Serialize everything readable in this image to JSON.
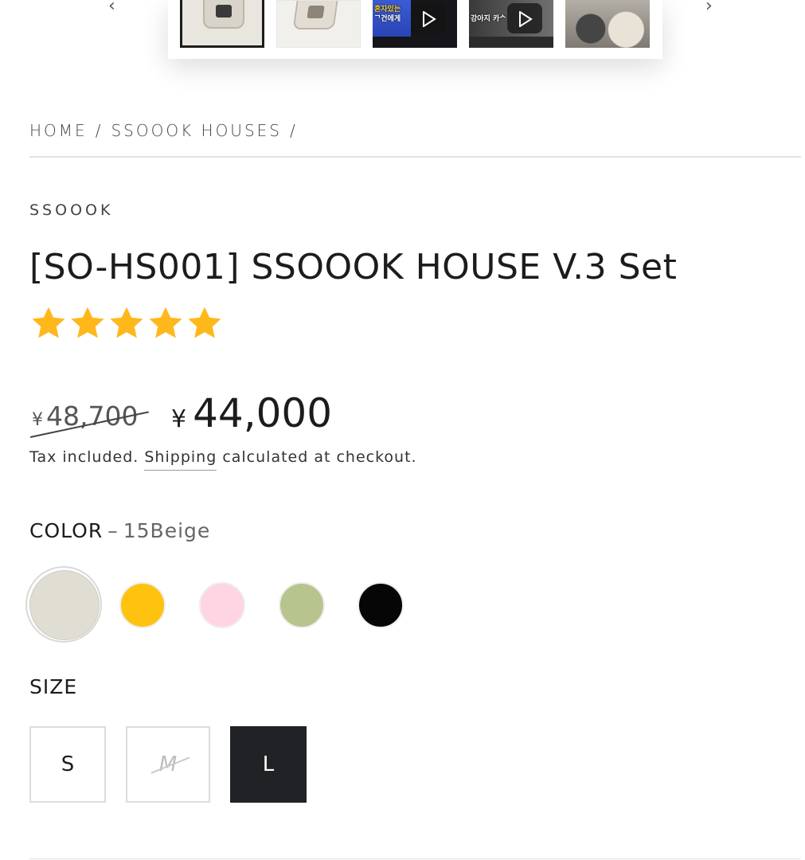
{
  "gallery": {
    "thumbnails": [
      {
        "name": "beige-house-front",
        "selected": true
      },
      {
        "name": "beige-house-angle",
        "selected": false
      },
      {
        "name": "video-1",
        "video": true,
        "caption_lines": [
          "혼자있는",
          "ᄀ건에게"
        ]
      },
      {
        "name": "video-2",
        "video": true,
        "caption_lines": [
          "강아지 카ᄉ"
        ]
      },
      {
        "name": "dog-in-house",
        "selected": false
      }
    ]
  },
  "breadcrumb": {
    "home": "HOME",
    "collection": "SSOOOK HOUSES",
    "separator": "/"
  },
  "product": {
    "vendor": "SSOOOK",
    "title": "[SO-HS001] SSOOOK HOUSE V.3 Set",
    "rating": 5,
    "price_old_currency": "¥",
    "price_old_amount": "48,700",
    "price_new_currency": "¥",
    "price_new_amount": "44,000",
    "tax_prefix": "Tax included.",
    "tax_link": "Shipping",
    "tax_suffix": "calculated at checkout."
  },
  "color": {
    "label": "COLOR",
    "dash": "–",
    "selected_value": "15Beige",
    "swatches": [
      {
        "name": "beige",
        "hex": "#e0ddd2",
        "selected": true
      },
      {
        "name": "yellow",
        "hex": "#ffc20e",
        "selected": false
      },
      {
        "name": "pink",
        "hex": "#ffd5e3",
        "selected": false
      },
      {
        "name": "green",
        "hex": "#b8c48e",
        "selected": false
      },
      {
        "name": "black",
        "hex": "#060606",
        "selected": false
      }
    ]
  },
  "size": {
    "label": "SIZE",
    "options": [
      {
        "label": "S",
        "available": true,
        "selected": false
      },
      {
        "label": "M",
        "available": false,
        "selected": false
      },
      {
        "label": "L",
        "available": true,
        "selected": true
      }
    ]
  },
  "colors": {
    "star": "#ffb81c",
    "text": "#1c1c1c",
    "selected_size_bg": "#212226"
  }
}
